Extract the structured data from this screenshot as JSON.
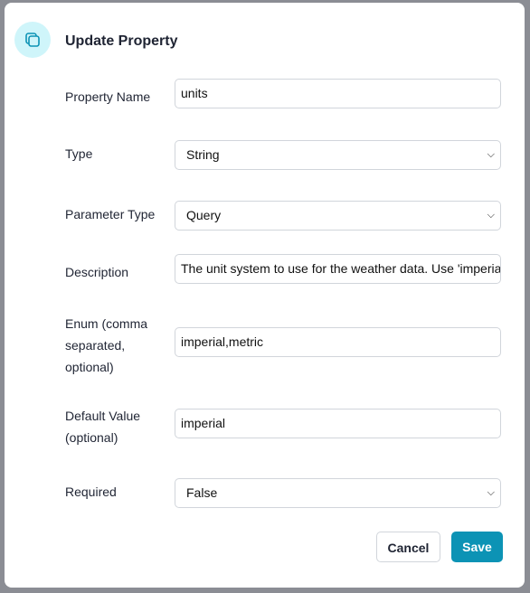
{
  "dialog": {
    "title": "Update Property",
    "icon": "copy-icon",
    "accent": "#0c93b5"
  },
  "fields": {
    "property_name": {
      "label": "Property Name",
      "value": "units"
    },
    "type": {
      "label": "Type",
      "value": "String"
    },
    "parameter_type": {
      "label": "Parameter Type",
      "value": "Query"
    },
    "description": {
      "label": "Description",
      "value": "The unit system to use for the weather data. Use 'imperial' or 'metric'."
    },
    "enum": {
      "label_lines": [
        "Enum (comma",
        "separated,",
        "optional)"
      ],
      "value": "imperial,metric"
    },
    "default_value": {
      "label_lines": [
        "Default Value",
        "(optional)"
      ],
      "value": "imperial"
    },
    "required": {
      "label": "Required",
      "value": "False"
    }
  },
  "buttons": {
    "cancel": "Cancel",
    "save": "Save"
  }
}
